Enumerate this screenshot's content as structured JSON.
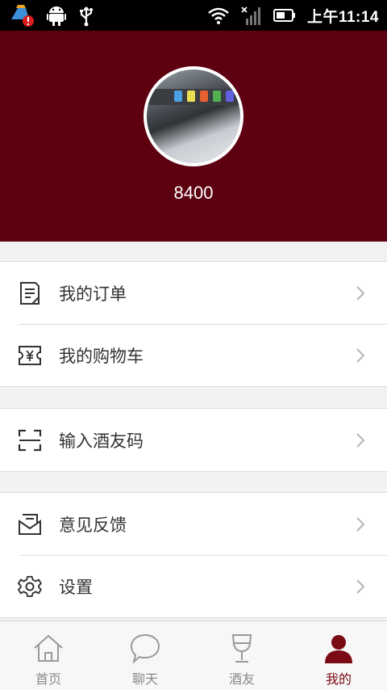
{
  "status_bar": {
    "time": "上午11:14",
    "icons": [
      "cleaner-alert-icon",
      "android-icon",
      "usb-icon",
      "wifi-icon",
      "signal-icon",
      "battery-icon"
    ]
  },
  "profile": {
    "username": "8400",
    "background_color": "#5d0010"
  },
  "menu": {
    "group1": [
      {
        "label": "我的订单",
        "icon": "order-list-icon"
      },
      {
        "label": "我的购物车",
        "icon": "ticket-yen-icon"
      }
    ],
    "group2": [
      {
        "label": "输入酒友码",
        "icon": "scan-frame-icon"
      }
    ],
    "group3": [
      {
        "label": "意见反馈",
        "icon": "feedback-mail-icon"
      },
      {
        "label": "设置",
        "icon": "gear-icon"
      }
    ]
  },
  "tabbar": {
    "tabs": [
      {
        "label": "首页",
        "icon": "home-icon",
        "active": false
      },
      {
        "label": "聊天",
        "icon": "chat-bubble-icon",
        "active": false
      },
      {
        "label": "酒友",
        "icon": "wine-glass-icon",
        "active": false
      },
      {
        "label": "我的",
        "icon": "person-icon",
        "active": true
      }
    ],
    "active_color": "#7a0a14",
    "inactive_color": "#888888"
  }
}
